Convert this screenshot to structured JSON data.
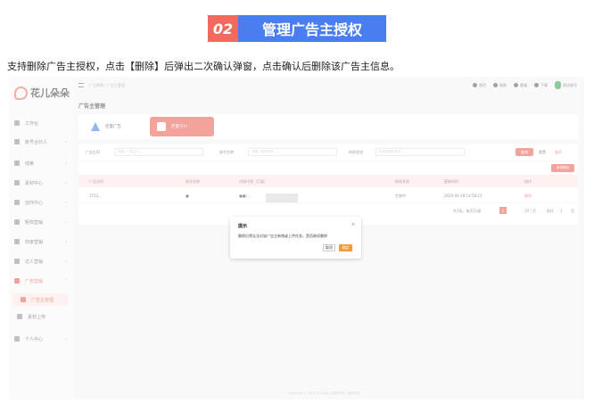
{
  "banner": {
    "number": "02",
    "title": "管理广告主授权"
  },
  "description": "支持删除广告主授权，点击【删除】后弹出二次确认弹窗，点击确认后删除该广告主信息。",
  "sidebar": {
    "logo": "花儿朵朵",
    "items": [
      {
        "label": "工作台"
      },
      {
        "label": "账号合伙人"
      },
      {
        "label": "线索"
      },
      {
        "label": "素材中心"
      },
      {
        "label": "创作中心"
      },
      {
        "label": "矩阵营销"
      },
      {
        "label": "商家营销"
      },
      {
        "label": "达人营销"
      },
      {
        "label": "广告营销"
      },
      {
        "label": "广告主管理"
      },
      {
        "label": "素材上传"
      },
      {
        "label": "个人中心"
      }
    ]
  },
  "topbar": {
    "breadcrumb": "广告营销 / 广告主管理",
    "links": [
      "首页",
      "帮助",
      "客服",
      "下载"
    ],
    "user": "测试账号"
  },
  "page": {
    "title": "广告主管理",
    "platforms": [
      "巨量广告",
      "巨量千川"
    ]
  },
  "filter": {
    "fields": [
      {
        "label": "广告主ID",
        "placeholder": "请输入广告主ID"
      },
      {
        "label": "账号名称",
        "placeholder": "请输入账号名称"
      },
      {
        "label": "授权状态",
        "placeholder": "请选择授权状态"
      }
    ],
    "search": "查询",
    "reset": "重置",
    "expand": "展开"
  },
  "table": {
    "add_button": "新增授权",
    "columns": [
      "广告主ID",
      "账号名称",
      "对接代理（巨量）",
      "授权状态",
      "更新时间",
      "操作"
    ],
    "rows": [
      {
        "id": "1712...",
        "account": "■",
        "agent": "■■(...",
        "status": "生效中",
        "updated": "2024-04-18 14:58:21",
        "action": "删除"
      }
    ],
    "pagination": {
      "total": "共1条，每页10条",
      "page": "1",
      "per_page": "10 / 页",
      "goto": "前往",
      "goto_page": "1",
      "unit": "页"
    }
  },
  "footer": "Copyright © 2024 花儿朵朵 | 版权所有 | 备案信息",
  "modal": {
    "title": "提示",
    "close": "×",
    "message": "删除后将无法对该广告主新增或上传任务，是否继续删除",
    "cancel": "取消",
    "confirm": "确定"
  },
  "colors": {
    "banner_num_bg": "#f06a5e",
    "banner_title_bg": "#4a7ef0",
    "accent_red": "#e8594c",
    "confirm_orange": "#f29b38"
  }
}
